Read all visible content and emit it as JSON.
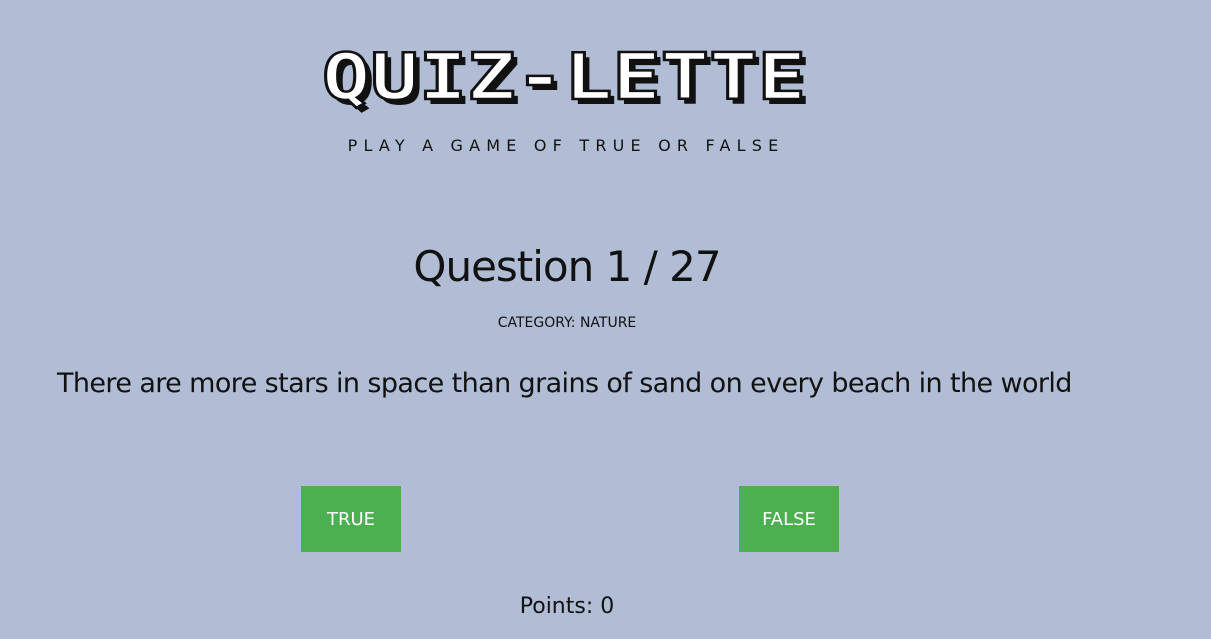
{
  "header": {
    "logo_text": "QUIZ-LETTE",
    "subtitle": "PLAY A GAME OF TRUE OR FALSE"
  },
  "quiz": {
    "question_counter": "Question 1 / 27",
    "category": "CATEGORY: NATURE",
    "question_text": "There are more stars in space than grains of sand on every beach in the world",
    "true_label": "TRUE",
    "false_label": "FALSE",
    "points_text": "Points: 0"
  },
  "colors": {
    "background": "#b0bdd5",
    "button": "#4caf50",
    "button_text": "#ffffff",
    "text": "#111111"
  }
}
